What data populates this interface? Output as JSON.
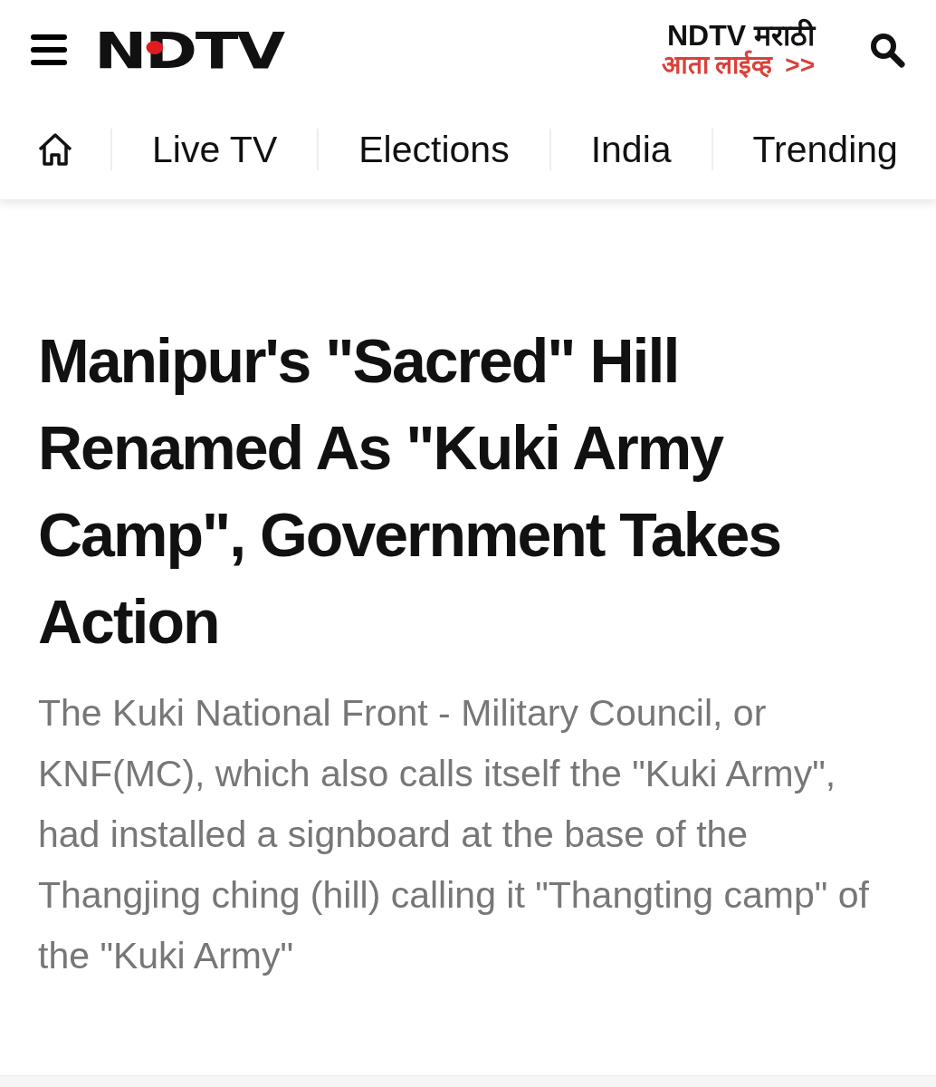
{
  "header": {
    "logo": "NDTV",
    "promo": {
      "title": "NDTV मराठी",
      "subtitle": "आता लाईव्ह",
      "arrow": ">>"
    }
  },
  "nav": {
    "items": [
      {
        "label": "Live TV"
      },
      {
        "label": "Elections"
      },
      {
        "label": "India"
      },
      {
        "label": "Trending"
      }
    ]
  },
  "article": {
    "headline": "Manipur's \"Sacred\" Hill Renamed As \"Kuki Army Camp\", Government Takes Action",
    "summary": "The Kuki National Front - Military Council, or KNF(MC), which also calls itself the \"Kuki Army\", had installed a signboard at the base of the Thangjing ching (hill) calling it \"Thangting camp\" of the \"Kuki Army\""
  }
}
